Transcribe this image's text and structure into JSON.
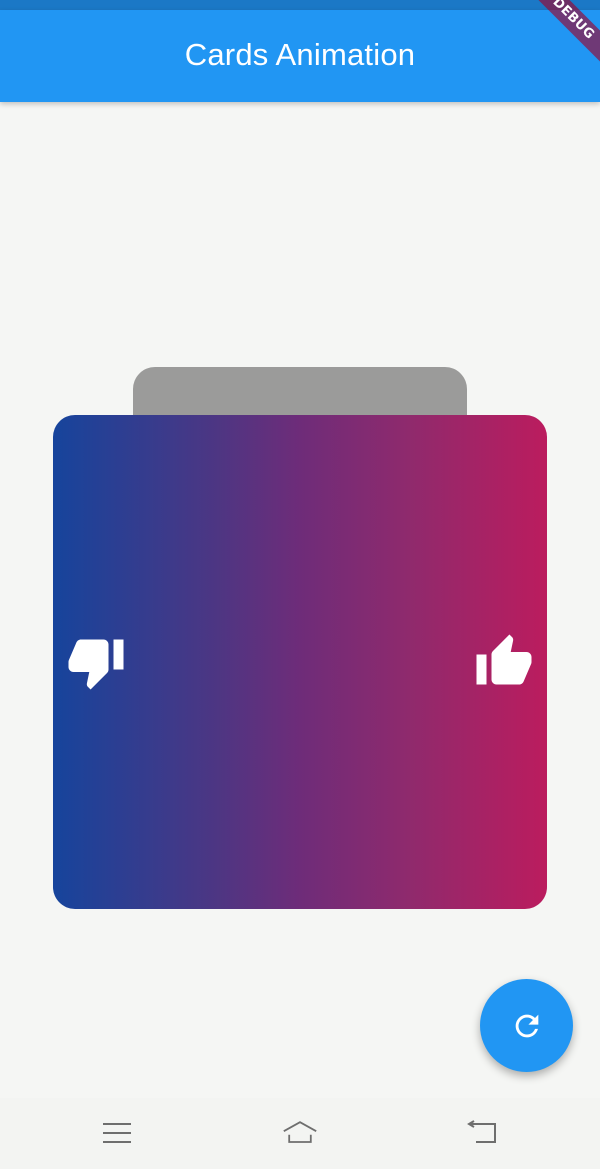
{
  "app_bar": {
    "title": "Cards Animation",
    "color": "#2196f3"
  },
  "debug_banner": {
    "label": "DEBUG"
  },
  "cards": {
    "front": {
      "gradient_start": "#16449c",
      "gradient_end": "#bb1c5e",
      "left_icon": "thumb-down-icon",
      "right_icon": "thumb-up-icon"
    },
    "back": {
      "color": "#9b9b9a"
    }
  },
  "fab": {
    "icon": "refresh-icon",
    "color": "#2196f3"
  },
  "nav_bar": {
    "items": [
      "menu-icon",
      "home-icon",
      "back-icon"
    ]
  }
}
